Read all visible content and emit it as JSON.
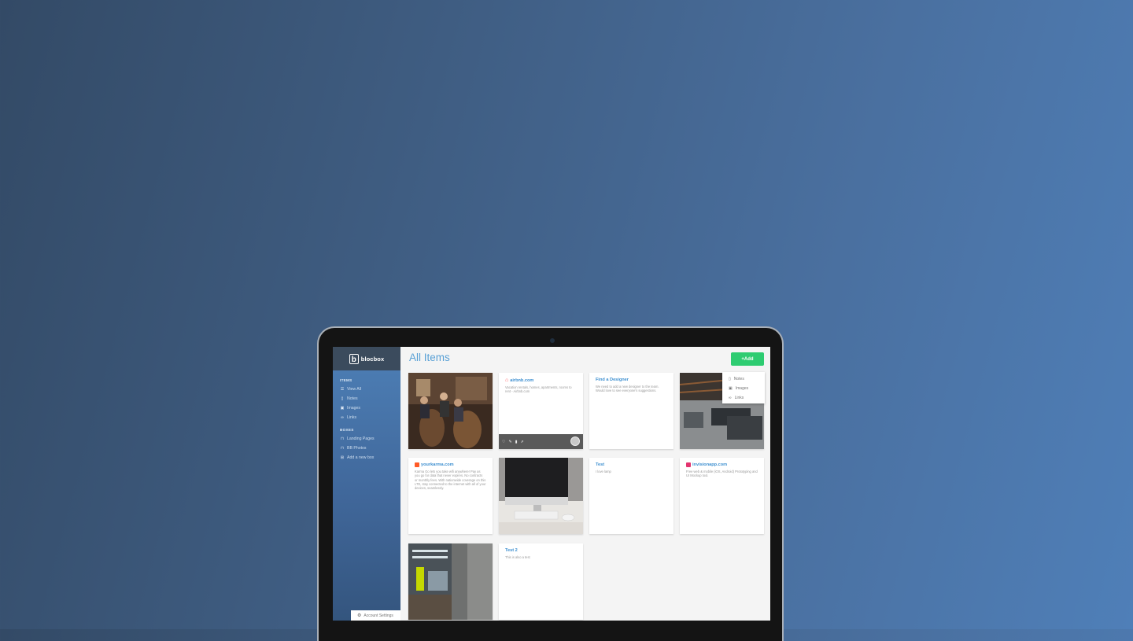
{
  "brand": {
    "logo_letter": "b",
    "name": "blocbox"
  },
  "sidebar": {
    "items_heading": "ITEMS",
    "items": [
      {
        "label": "View All",
        "icon": "list-icon"
      },
      {
        "label": "Notes",
        "icon": "note-icon"
      },
      {
        "label": "Images",
        "icon": "image-icon"
      },
      {
        "label": "Links",
        "icon": "link-icon"
      }
    ],
    "boxes_heading": "BOXES",
    "boxes": [
      {
        "label": "Landing Pages",
        "icon": "inbox-icon"
      },
      {
        "label": "BB Photos",
        "icon": "inbox-icon"
      },
      {
        "label": "Add a new box",
        "icon": "plus-box-icon"
      }
    ],
    "account_label": "Account Settings"
  },
  "main": {
    "title": "All Items",
    "add_label": "+Add",
    "add_menu": [
      {
        "label": "Notes",
        "icon": "note-icon"
      },
      {
        "label": "Images",
        "icon": "image-icon"
      },
      {
        "label": "Links",
        "icon": "link-icon"
      }
    ]
  },
  "cards": {
    "airbnb": {
      "title": "airbnb.com",
      "text": "Vacation rentals, homes, apartments, rooms to rent - Airbnb.com"
    },
    "designer": {
      "title": "Find a Designer",
      "text": "We need to add a new designer to the team. Would love to see everyone's suggestions."
    },
    "karma": {
      "title": "yourkarma.com",
      "text": "Karma Go lets you take wifi anywhere! Pay as you go for data that never expires. No contracts or monthly fees. With nationwide coverage on this LTE, stay connected to the internet with all of your devices, seamlessly."
    },
    "test": {
      "title": "Test",
      "text": "I love lamp"
    },
    "invision": {
      "title": "invisionapp.com",
      "text": "Free web & mobile (iOS, Android) Prototyping and UI Mockup tool."
    },
    "test2": {
      "title": "Test 2",
      "text": "This is also a test"
    }
  },
  "colors": {
    "accent": "#5aa1d6",
    "add_button": "#2ecc71",
    "sidebar_top": "#4d7fb6",
    "brand_bar": "#3b4b5d"
  }
}
